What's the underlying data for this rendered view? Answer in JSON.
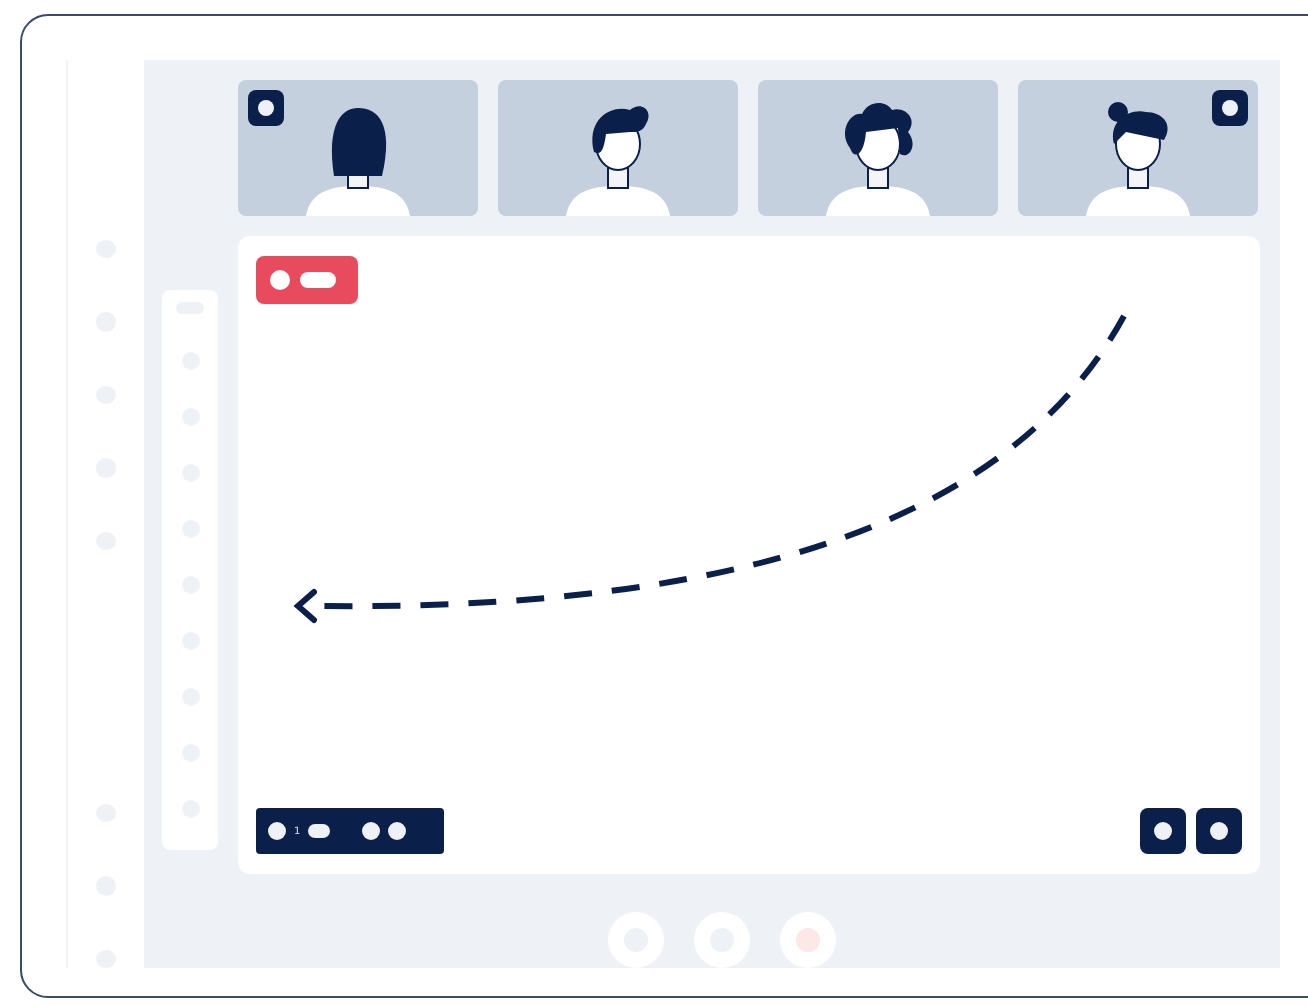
{
  "participants": [
    {
      "kind": "long",
      "badge": true
    },
    {
      "kind": "quiff",
      "badge": false
    },
    {
      "kind": "curly",
      "badge": false
    },
    {
      "kind": "bun",
      "badge": true
    }
  ],
  "stage": {
    "recording": true,
    "toolbar": {
      "count": "1"
    }
  },
  "controls": [
    {
      "color": "#eef1f6"
    },
    {
      "color": "#eef1f6"
    },
    {
      "color": "#fde8e8"
    }
  ]
}
